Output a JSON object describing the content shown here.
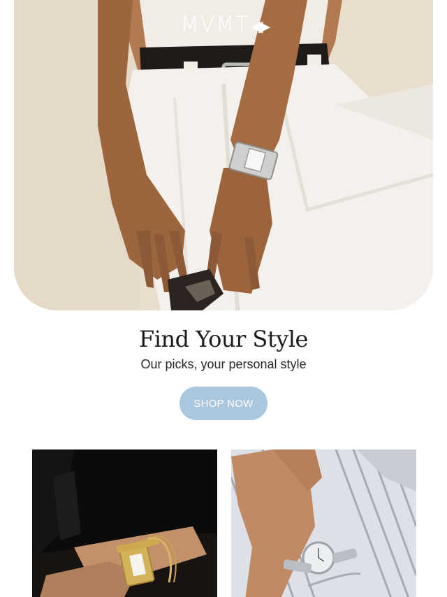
{
  "brand": {
    "logo_text": "MVMT",
    "logo_mark": "◀▶"
  },
  "hero": {
    "image_desc": "hero-photo"
  },
  "promo": {
    "headline": "Find Your Style",
    "subheadline": "Our picks, your personal style",
    "cta_label": "SHOP NOW",
    "cta_color": "#a9c7de"
  },
  "tiles": [
    {
      "name": "gold-watch-tile"
    },
    {
      "name": "silver-watch-tile"
    }
  ]
}
